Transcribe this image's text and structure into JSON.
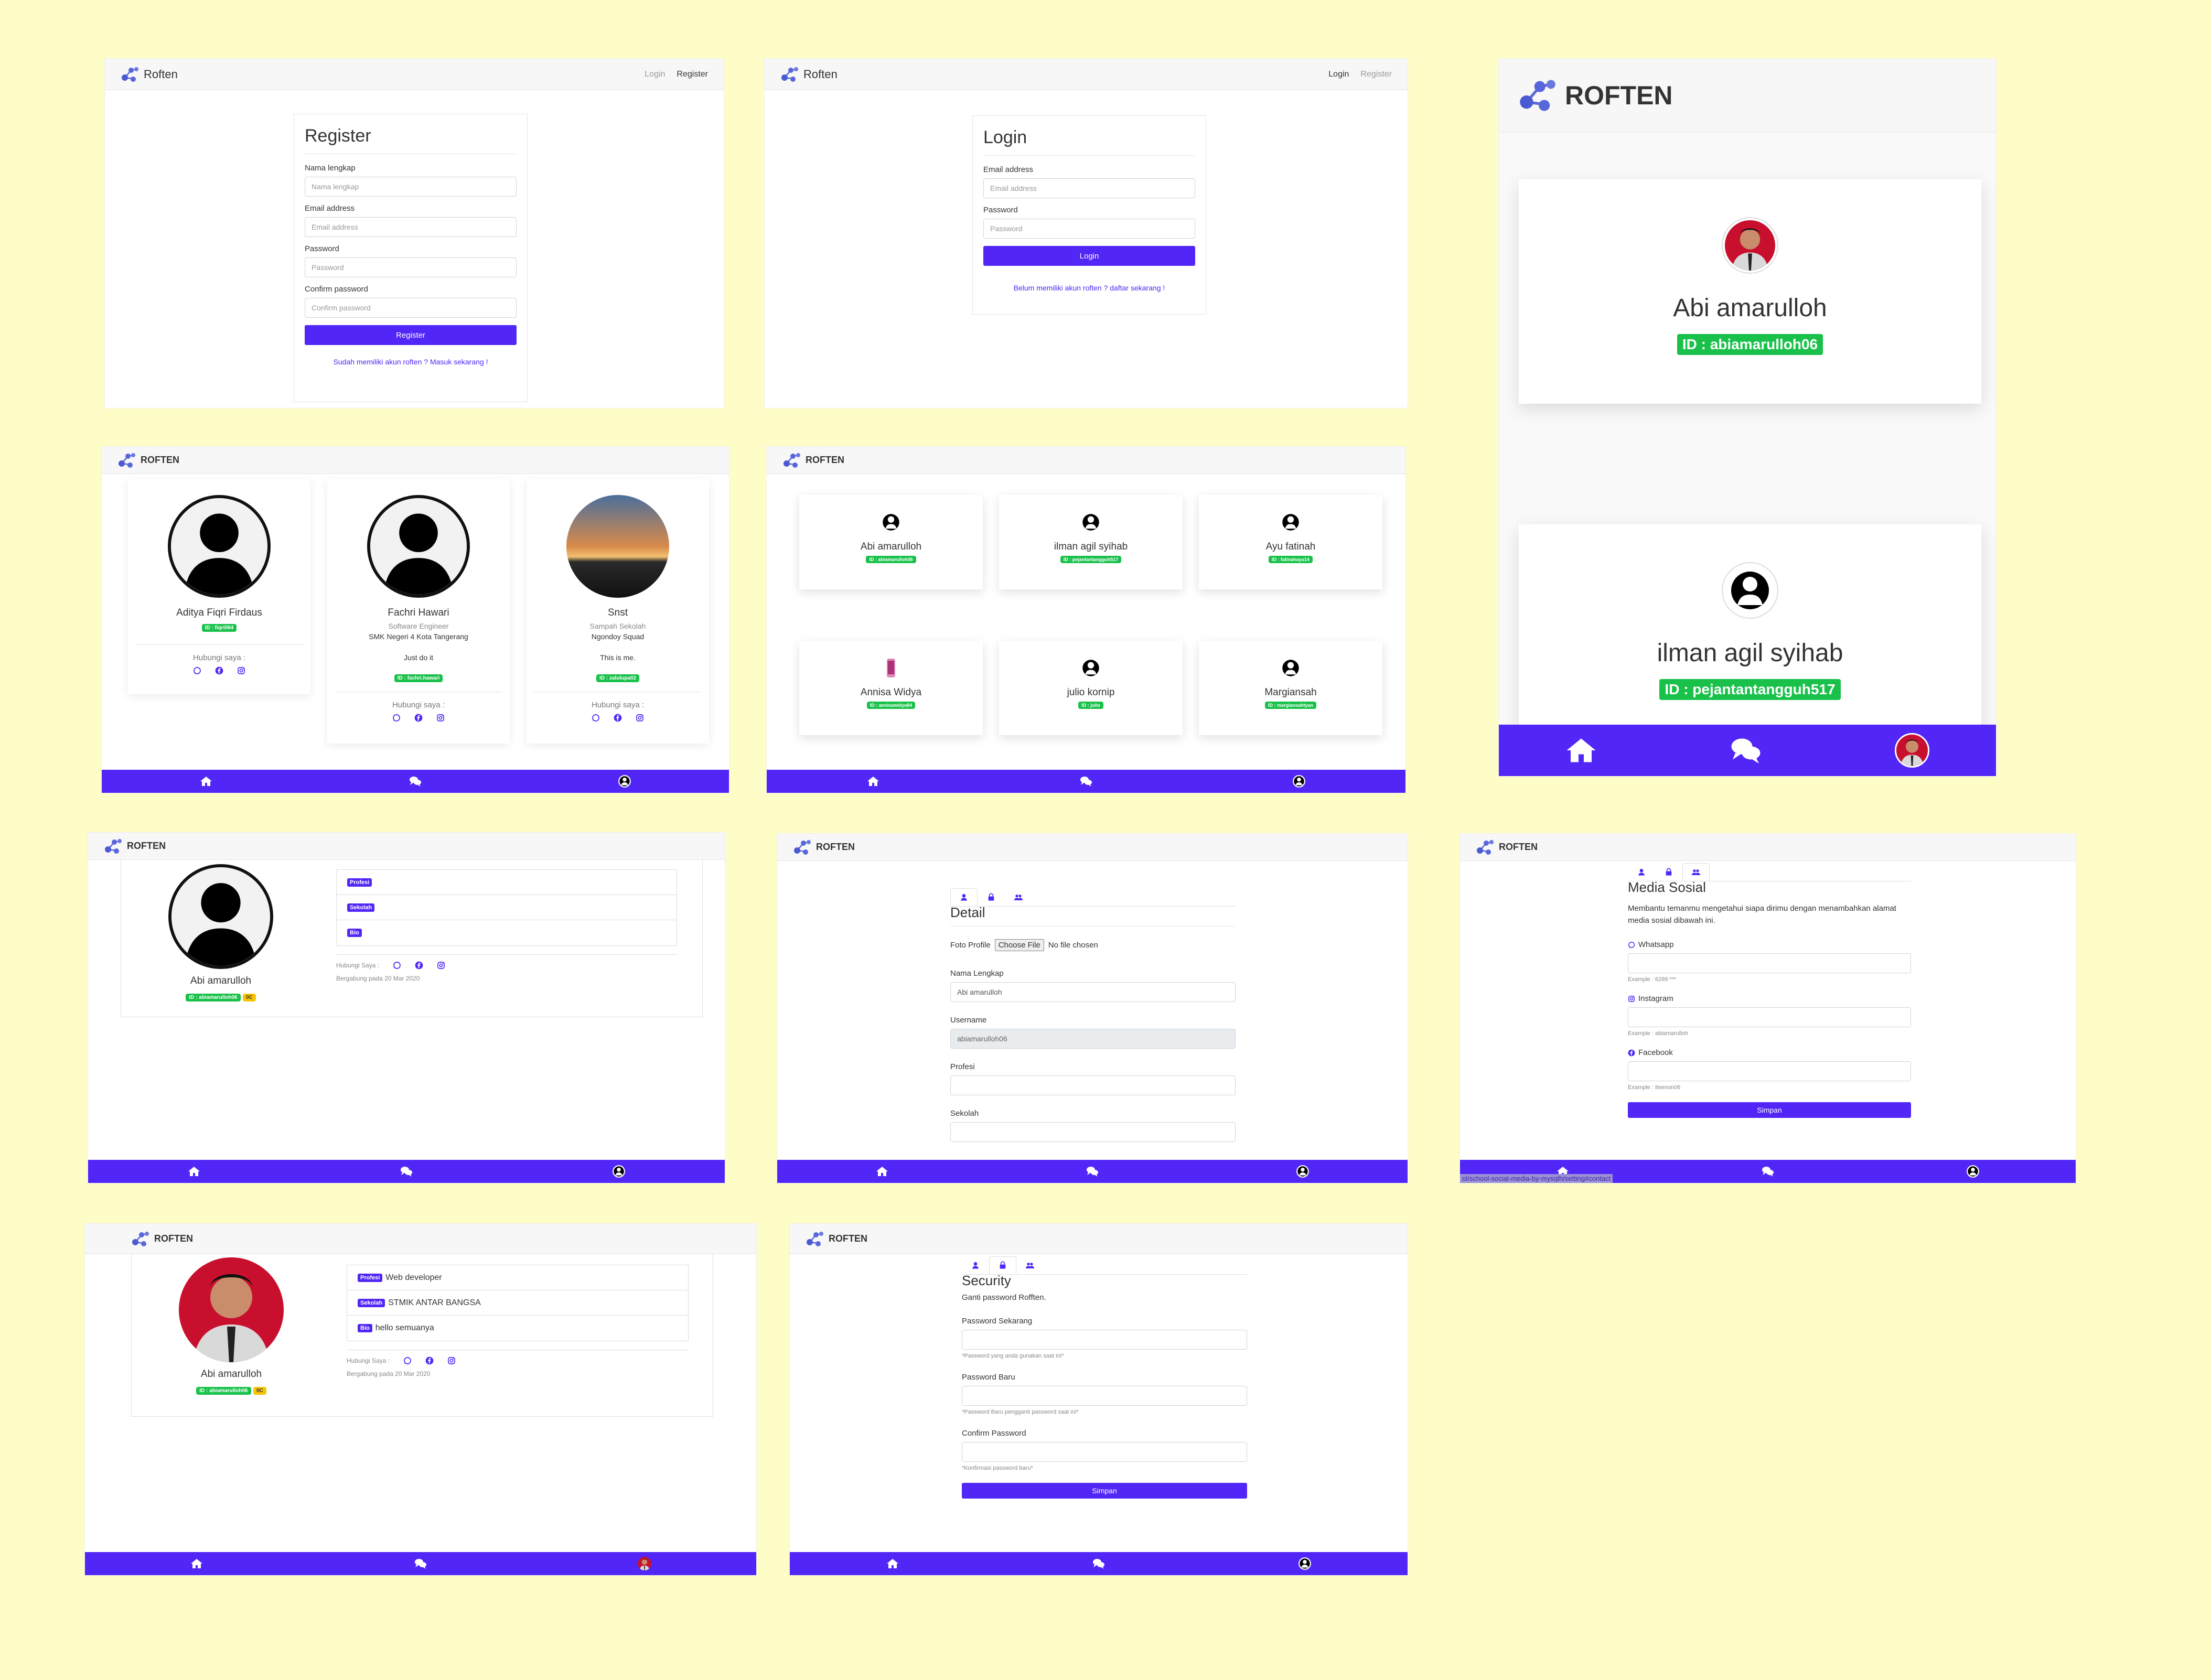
{
  "brand": {
    "name_title": "Roften",
    "name_caps": "ROFTEN"
  },
  "colors": {
    "accent": "#5126f6",
    "badge_green": "#19c14a",
    "badge_yellow": "#f7c400",
    "background": "#fffdc7"
  },
  "nav": {
    "login": "Login",
    "register": "Register"
  },
  "register": {
    "title": "Register",
    "fields": [
      {
        "label": "Nama lengkap",
        "placeholder": "Nama lengkap"
      },
      {
        "label": "Email address",
        "placeholder": "Email address"
      },
      {
        "label": "Password",
        "placeholder": "Password"
      },
      {
        "label": "Confirm password",
        "placeholder": "Confirm password"
      }
    ],
    "button": "Register",
    "link": "Sudah memiliki akun roften ? Masuk sekarang !"
  },
  "login": {
    "title": "Login",
    "fields": [
      {
        "label": "Email address",
        "placeholder": "Email address"
      },
      {
        "label": "Password",
        "placeholder": "Password"
      }
    ],
    "button": "Login",
    "link": "Belum memiliki akun roften ? daftar sekarang !"
  },
  "mobile": {
    "users": [
      {
        "name": "Abi amarulloh",
        "id": "ID : abiamarulloh06"
      },
      {
        "name": "ilman agil syihab",
        "id": "ID : pejantantangguh517"
      }
    ]
  },
  "cards3": [
    {
      "name": "Aditya Fiqri Firdaus",
      "id": "ID : fiqri064",
      "profession": "",
      "school": "",
      "bio": "",
      "contact": "Hubungi saya :"
    },
    {
      "name": "Fachri Hawari",
      "id": "ID : fachri.hawari",
      "profession": "Software Engineer",
      "school": "SMK Negeri 4 Kota Tangerang",
      "bio": "Just do it",
      "contact": "Hubungi saya :"
    },
    {
      "name": "Snst",
      "id": "ID : zalulupa02",
      "profession": "Sampah Sekolah",
      "school": "Ngondoy Squad",
      "bio": "This is me.",
      "contact": "Hubungi saya :"
    }
  ],
  "grid6": [
    {
      "name": "Abi amarulloh",
      "id": "ID : abiamarulloh06"
    },
    {
      "name": "ilman agil syihab",
      "id": "ID : pejantantangguh517"
    },
    {
      "name": "Ayu fatinah",
      "id": "ID : fatinahayu14"
    },
    {
      "name": "Annisa Widya",
      "id": "ID : annisawidya84"
    },
    {
      "name": "julio kornip",
      "id": "ID : julio"
    },
    {
      "name": "Margiansah",
      "id": "ID : margiansahtyan"
    }
  ],
  "profile_empty": {
    "name": "Abi amarulloh",
    "id": "ID : abiamarulloh06",
    "id_extra": "0C",
    "rows": [
      {
        "tag": "Profesi",
        "value": ""
      },
      {
        "tag": "Sekolah",
        "value": ""
      },
      {
        "tag": "Bio",
        "value": ""
      }
    ],
    "contact": "Hubungi Saya :",
    "joined": "Bergabung pada 20 Mar 2020"
  },
  "profile_filled": {
    "name": "Abi amarulloh",
    "id": "ID : abiamarulloh06",
    "id_extra": "0C",
    "rows": [
      {
        "tag": "Profesi",
        "value": "Web developer"
      },
      {
        "tag": "Sekolah",
        "value": "STMIK ANTAR BANGSA"
      },
      {
        "tag": "Bio",
        "value": "hello semuanya"
      }
    ],
    "contact": "Hubungi Saya :",
    "joined": "Bergabung pada 20 Mar 2020"
  },
  "detail": {
    "title": "Detail",
    "photo_label": "Foto Profile",
    "choose_file": "Choose File",
    "no_file": "No file chosen",
    "fields": [
      {
        "label": "Nama Lengkap",
        "value": "Abi amarulloh"
      },
      {
        "label": "Username",
        "value": "abiamarulloh06"
      },
      {
        "label": "Profesi",
        "value": ""
      },
      {
        "label": "Sekolah",
        "value": ""
      }
    ]
  },
  "social": {
    "title": "Media Sosial",
    "desc": "Membantu temanmu mengetahui siapa dirimu dengan menambahkan alamat media sosial dibawah ini.",
    "fields": [
      {
        "label": "Whatsapp",
        "hint": "Example : 6289 ***"
      },
      {
        "label": "Instagram",
        "hint": "Example : abiamarulloh"
      },
      {
        "label": "Facebook",
        "hint": "Example : iteenon06"
      }
    ],
    "button": "Simpan",
    "status_url": "ol/school-social-media-by-mysqlh/setting#contact"
  },
  "security": {
    "title": "Security",
    "desc": "Ganti password Rofften.",
    "fields": [
      {
        "label": "Password Sekarang",
        "hint": "*Password yang anda gunakan saat ini*"
      },
      {
        "label": "Password Baru",
        "hint": "*Password Baru pengganti password saat ini*"
      },
      {
        "label": "Confirm Password",
        "hint": "*Konfirmasi password baru*"
      }
    ],
    "button": "Simpan"
  },
  "icons": [
    "logo-icon",
    "home-icon",
    "chat-icon",
    "user-icon",
    "whatsapp-icon",
    "facebook-icon",
    "instagram-icon",
    "lock-icon",
    "users-icon"
  ]
}
